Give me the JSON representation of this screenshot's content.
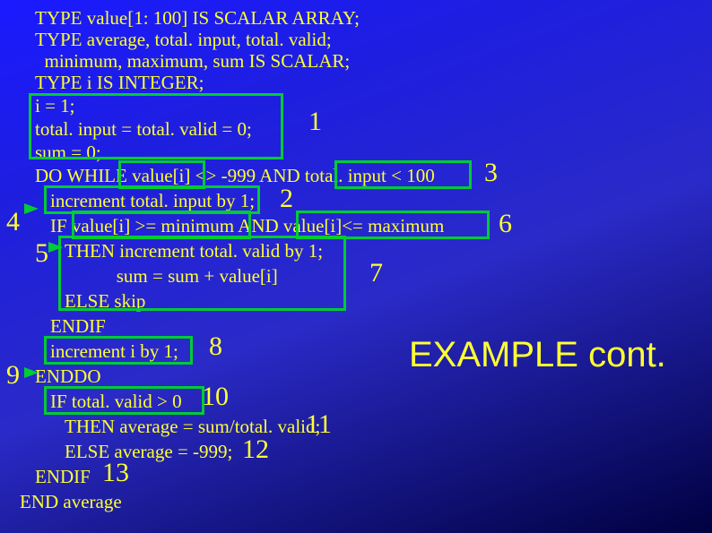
{
  "code": {
    "l1": "TYPE value[1: 100] IS SCALAR ARRAY;",
    "l2": "TYPE average, total. input, total. valid;",
    "l3": "  minimum, maximum, sum IS SCALAR;",
    "l4": "TYPE i IS INTEGER;",
    "l5": "i = 1;",
    "l6": "total. input = total. valid = 0;",
    "l7": "sum = 0;",
    "l8": "DO WHILE value[i] <> -999 AND total. input < 100",
    "l9": "increment total. input by 1;",
    "l10": "IF value[i] >= minimum AND value[i]<= maximum",
    "l11": "THEN increment total. valid by 1;",
    "l12": "           sum = sum + value[i]",
    "l13": "ELSE skip",
    "l14": "ENDIF",
    "l15": "increment i by 1;",
    "l16": "ENDDO",
    "l17": "IF total. valid > 0",
    "l18": "THEN average = sum/total. valid;",
    "l19": "ELSE average = -999;",
    "l20": "ENDIF",
    "l21": "END average"
  },
  "regions": {
    "r1": "1",
    "r2": "2",
    "r3": "3",
    "r4": "4",
    "r5": "5",
    "r6": "6",
    "r7": "7",
    "r8": "8",
    "r9": "9",
    "r10": "10",
    "r11": "11",
    "r12": "12",
    "r13": "13"
  },
  "title": "EXAMPLE cont."
}
